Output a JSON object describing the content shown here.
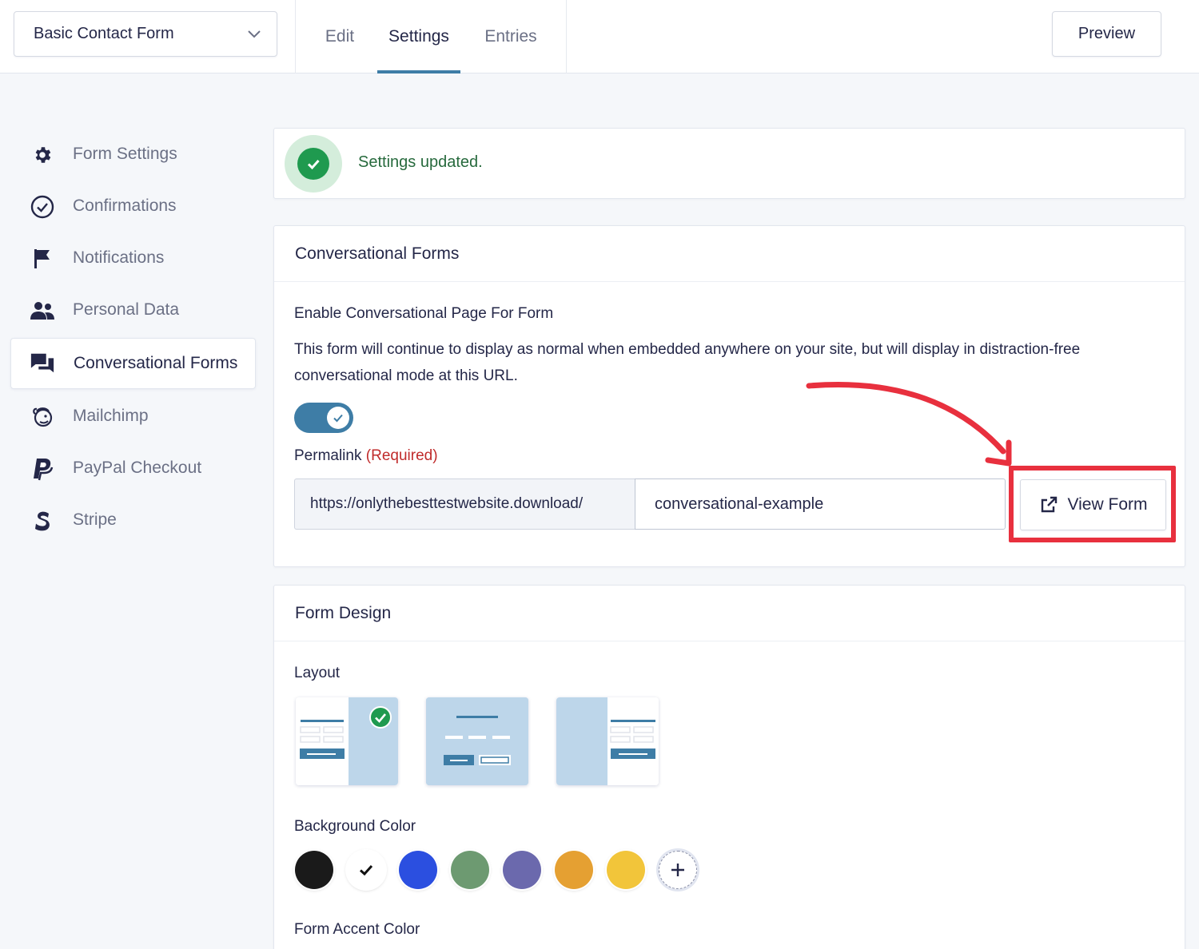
{
  "header": {
    "form_selector": "Basic Contact Form",
    "tabs": [
      {
        "label": "Edit",
        "active": false
      },
      {
        "label": "Settings",
        "active": true
      },
      {
        "label": "Entries",
        "active": false
      }
    ],
    "preview_label": "Preview"
  },
  "sidebar": {
    "items": [
      {
        "label": "Form Settings",
        "icon": "gear-icon",
        "active": false
      },
      {
        "label": "Confirmations",
        "icon": "check-circle-icon",
        "active": false
      },
      {
        "label": "Notifications",
        "icon": "flag-icon",
        "active": false
      },
      {
        "label": "Personal Data",
        "icon": "people-icon",
        "active": false
      },
      {
        "label": "Conversational Forms",
        "icon": "chat-bubbles-icon",
        "active": true
      },
      {
        "label": "Mailchimp",
        "icon": "mailchimp-icon",
        "active": false
      },
      {
        "label": "PayPal Checkout",
        "icon": "paypal-icon",
        "active": false
      },
      {
        "label": "Stripe",
        "icon": "stripe-icon",
        "active": false
      }
    ]
  },
  "notice": {
    "message": "Settings updated.",
    "icon": "check-circle-icon",
    "color": "#1f9a4f"
  },
  "conversational": {
    "title": "Conversational Forms",
    "enable_label": "Enable Conversational Page For Form",
    "description": "This form will continue to display as normal when embedded anywhere on your site, but will display in distraction-free conversational mode at this URL.",
    "enabled": true,
    "permalink_label": "Permalink",
    "required_label": "(Required)",
    "url_prefix": "https://onlythebesttestwebsite.download/",
    "slug": "conversational-example",
    "view_form_label": "View Form"
  },
  "design": {
    "title": "Form Design",
    "layout_label": "Layout",
    "layouts": [
      {
        "name": "layout-left-form",
        "selected": true
      },
      {
        "name": "layout-centered-form",
        "selected": false
      },
      {
        "name": "layout-right-form",
        "selected": false
      }
    ],
    "background_label": "Background Color",
    "background_colors": [
      "#1a1a1a",
      "#ffffff",
      "#2b4fe0",
      "#6d9a71",
      "#6b69ad",
      "#e5a032",
      "#f2c53a"
    ],
    "selected_background": "#ffffff",
    "accent_label": "Form Accent Color"
  },
  "annotation": {
    "highlight_color": "#e8303e"
  }
}
